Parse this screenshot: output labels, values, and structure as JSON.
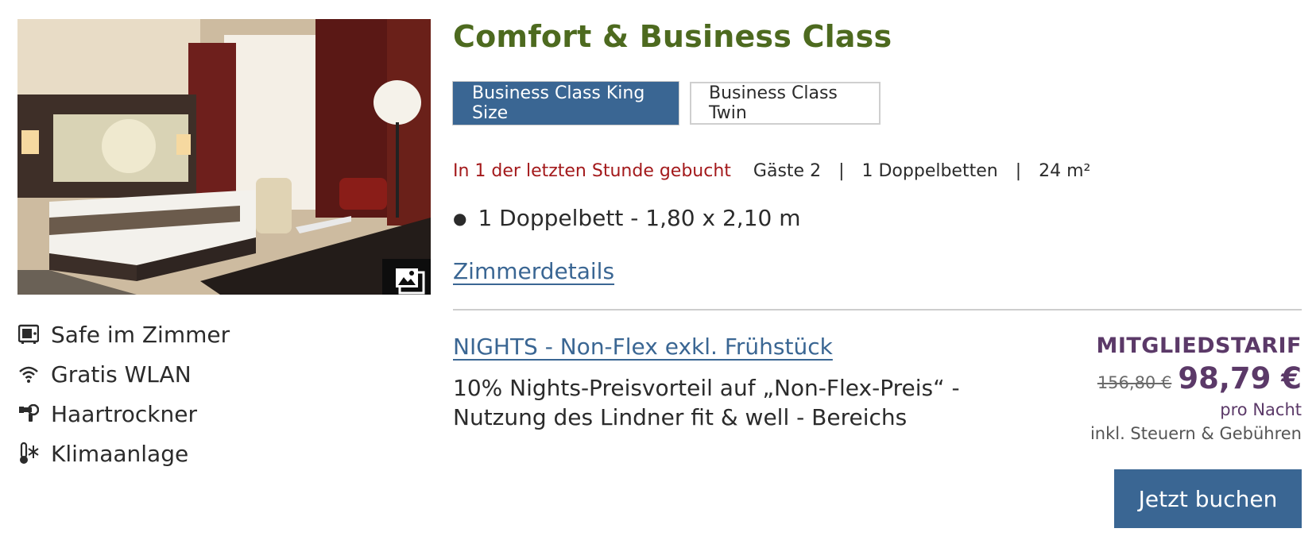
{
  "room": {
    "title": "Comfort & Business Class",
    "tabs": [
      {
        "label": "Business Class King Size",
        "active": true
      },
      {
        "label": "Business Class Twin",
        "active": false
      }
    ],
    "booked_notice": "In 1 der letzten Stunde gebucht",
    "guests": "Gäste 2",
    "beds": "1 Doppelbetten",
    "size": "24 m²",
    "bed_items": [
      "1 Doppelbett - 1,80 x 2,10 m"
    ],
    "details_link": "Zimmerdetails"
  },
  "amenities": [
    {
      "icon": "safe-icon",
      "label": "Safe im Zimmer"
    },
    {
      "icon": "wifi-icon",
      "label": "Gratis WLAN"
    },
    {
      "icon": "hairdryer-icon",
      "label": "Haartrockner"
    },
    {
      "icon": "air-conditioning-icon",
      "label": "Klimaanlage"
    }
  ],
  "rate": {
    "name": "NIGHTS - Non-Flex exkl. Frühstück",
    "description": "10% Nights-Preisvorteil auf „Non-Flex-Preis“ - Nutzung des Lindner fit & well - Bereichs",
    "member_label": "MITGLIEDSTARIF",
    "old_price": "156,80 €",
    "new_price": "98,79 €",
    "per_night": "pro Nacht",
    "tax_note": "inkl. Steuern & Gebühren",
    "book_label": "Jetzt buchen"
  },
  "colors": {
    "title_green": "#4d6a1f",
    "accent_blue": "#3a6693",
    "member_purple": "#5b3968",
    "alert_red": "#a3191b"
  }
}
